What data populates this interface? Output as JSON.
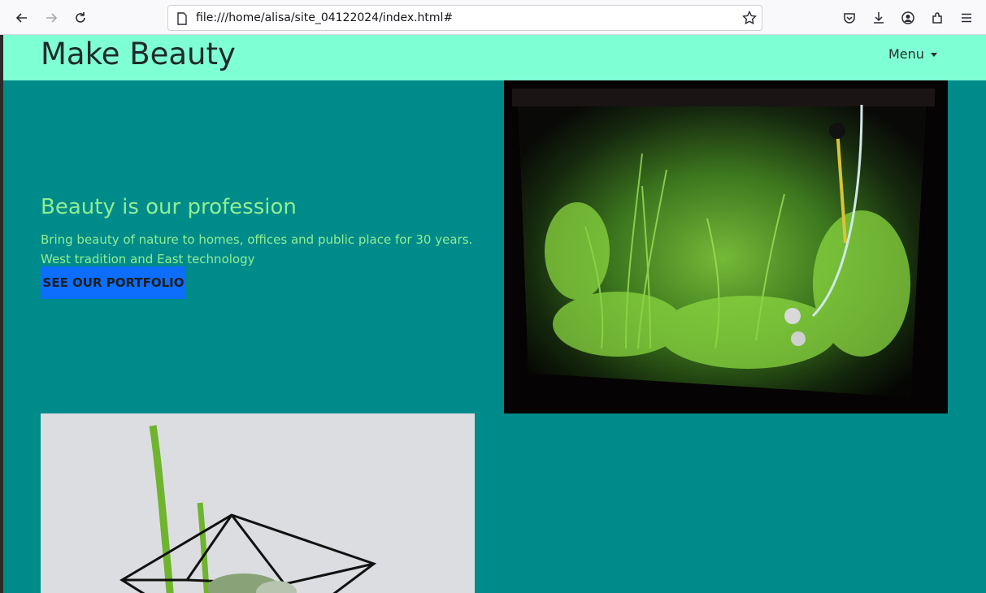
{
  "browser": {
    "url": "file:///home/alisa/site_04122024/index.html#",
    "icons": [
      "back-arrow-icon",
      "forward-arrow-icon",
      "reload-icon",
      "page-icon",
      "bookmark-star-icon",
      "pocket-icon",
      "download-icon",
      "account-icon",
      "extensions-icon",
      "hamburger-menu-icon"
    ]
  },
  "site": {
    "brand": "Make Beauty",
    "menu_label": "Menu",
    "hero": {
      "title": "Beauty is our profession",
      "text": "Bring beauty of nature to homes, offices and public place for 30 years. West tradition and East technology",
      "button_label": "SEE OUR PORTFOLIO"
    },
    "images": [
      "planted aquarium photo",
      "geometric glass terrarium photo"
    ]
  },
  "colors": {
    "page_bg": "#008b8b",
    "navbar_bg": "#7fffd4",
    "hero_text": "#90ee90",
    "button_bg": "#0d6efd"
  }
}
